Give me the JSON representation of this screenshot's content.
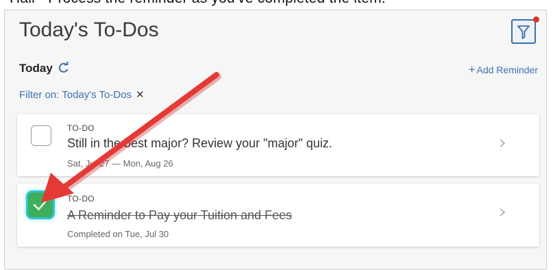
{
  "header_cut_text": "Hall - Process the reminder as you've completed the item.",
  "page": {
    "title": "Today's To-Dos",
    "filter_icon": "filter-icon",
    "today_label": "Today",
    "refresh_icon": "refresh-icon",
    "add_reminder_plus": "+",
    "add_reminder_label": "Add Reminder",
    "filter_chip_label": "Filter on: Today's To-Dos",
    "filter_chip_close": "✕"
  },
  "todos": [
    {
      "type": "TO-DO",
      "title": "Still in the best major? Review your \"major\" quiz.",
      "subtitle": "Sat, Jul 27 — Mon, Aug 26",
      "completed": false
    },
    {
      "type": "TO-DO",
      "title": "A Reminder to Pay your Tuition and Fees",
      "subtitle": "Completed on Tue, Jul 30",
      "completed": true
    }
  ],
  "annotation": {
    "arrow_color": "#e53935"
  },
  "colors": {
    "accent": "#3b6fb0",
    "check_green": "#3fae5a",
    "highlight_cyan": "#2ec4d6",
    "notification_dot": "#d9342b"
  }
}
